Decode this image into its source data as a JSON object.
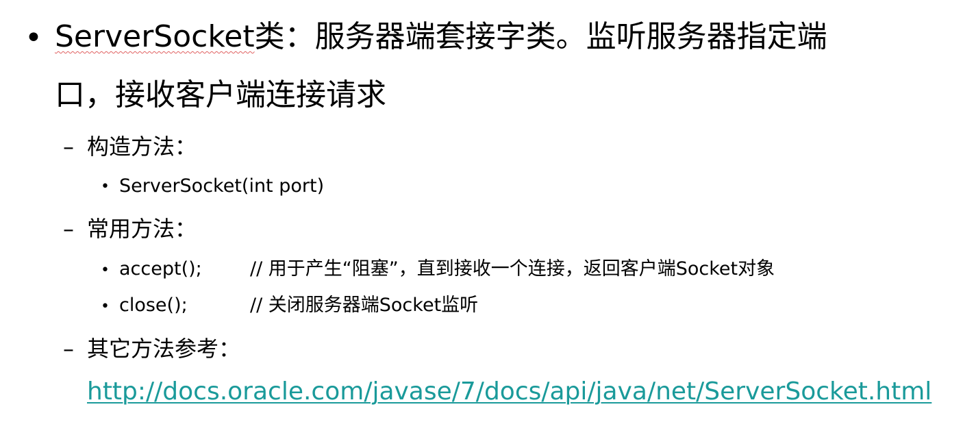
{
  "slide": {
    "main": {
      "bullet": "•",
      "term": "ServerSocket",
      "line1_rest": "类：服务器端套接字类。监听服务器指定端",
      "line2": "口，接收客户端连接请求"
    },
    "constructor_section": {
      "dash": "–",
      "heading": "构造方法：",
      "items": [
        {
          "bullet": "•",
          "code": "ServerSocket(int  port)"
        }
      ]
    },
    "methods_section": {
      "dash": "–",
      "heading": "常用方法：",
      "items": [
        {
          "bullet": "•",
          "code": "accept();",
          "comment": "// 用于产生“阻塞”，直到接收一个连接，返回客户端Socket对象"
        },
        {
          "bullet": "•",
          "code": "close();",
          "comment": "// 关闭服务器端Socket监听"
        }
      ]
    },
    "reference_section": {
      "dash": "–",
      "heading": "其它方法参考：",
      "link": "http://docs.oracle.com/javase/7/docs/api/java/net/ServerSocket.html"
    },
    "colors": {
      "text": "#000000",
      "link": "#1a9a9a",
      "spellcheck_underline": "#e06060"
    }
  }
}
